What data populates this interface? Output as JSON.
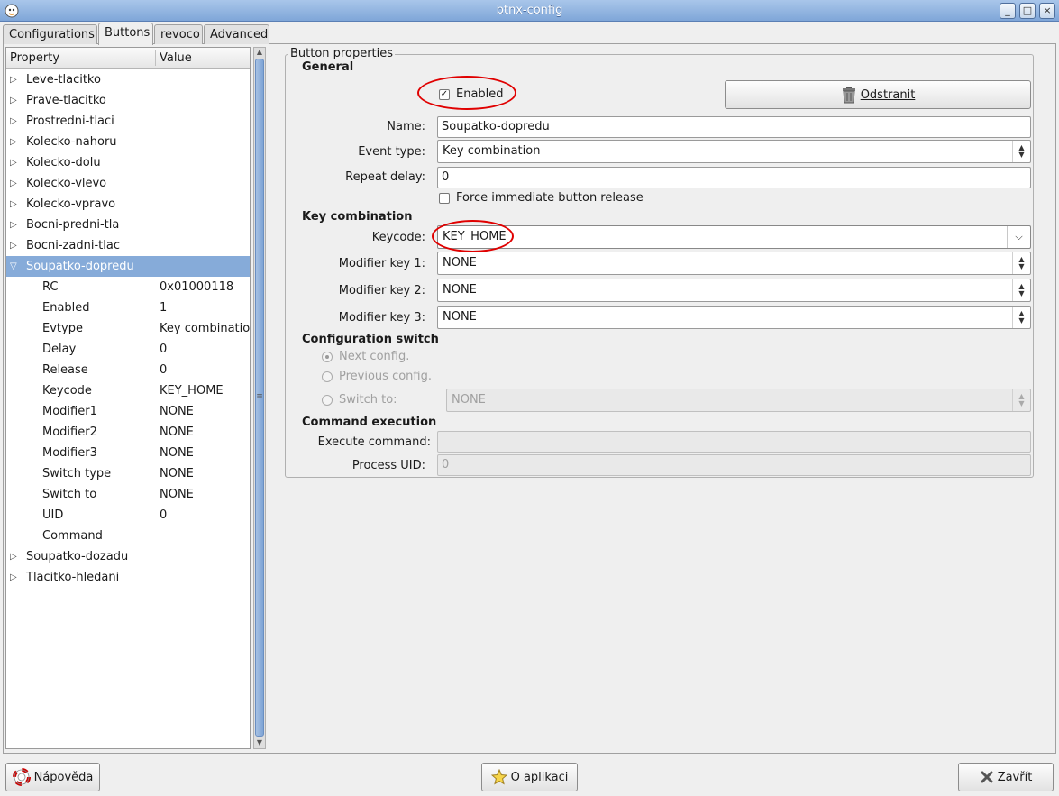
{
  "window": {
    "title": "btnx-config",
    "buttons": [
      "_",
      "□",
      "×"
    ]
  },
  "tabs": [
    {
      "label": "Configurations",
      "active": false
    },
    {
      "label": "Buttons",
      "active": true
    },
    {
      "label": "revoco",
      "active": false
    },
    {
      "label": "Advanced",
      "active": false
    }
  ],
  "tree": {
    "headers": {
      "property": "Property",
      "value": "Value"
    },
    "items_before": [
      "Leve-tlacitko",
      "Prave-tlacitko",
      "Prostredni-tlaci",
      "Kolecko-nahoru",
      "Kolecko-dolu",
      "Kolecko-vlevo",
      "Kolecko-vpravo",
      "Bocni-predni-tla",
      "Bocni-zadni-tlac"
    ],
    "selected": "Soupatko-dopredu",
    "children": [
      {
        "name": "RC",
        "value": "0x01000118"
      },
      {
        "name": "Enabled",
        "value": "1"
      },
      {
        "name": "Evtype",
        "value": "Key combinatio"
      },
      {
        "name": "Delay",
        "value": "0"
      },
      {
        "name": "Release",
        "value": "0"
      },
      {
        "name": "Keycode",
        "value": "KEY_HOME"
      },
      {
        "name": "Modifier1",
        "value": "NONE"
      },
      {
        "name": "Modifier2",
        "value": "NONE"
      },
      {
        "name": "Modifier3",
        "value": "NONE"
      },
      {
        "name": "Switch type",
        "value": "NONE"
      },
      {
        "name": "Switch to",
        "value": "NONE"
      },
      {
        "name": "UID",
        "value": "0"
      },
      {
        "name": "Command",
        "value": ""
      }
    ],
    "items_after": [
      "Soupatko-dozadu",
      "Tlacitko-hledani"
    ]
  },
  "props": {
    "frame_title": "Button properties",
    "general": {
      "heading": "General",
      "enabled_label": "Enabled",
      "enabled_checked": true,
      "remove_button": "Odstranit",
      "name_label": "Name:",
      "name_value": "Soupatko-dopredu",
      "event_type_label": "Event type:",
      "event_type_value": "Key combination",
      "repeat_delay_label": "Repeat delay:",
      "repeat_delay_value": "0",
      "force_release_label": "Force immediate button release",
      "force_release_checked": false
    },
    "keycomb": {
      "heading": "Key combination",
      "keycode_label": "Keycode:",
      "keycode_value": "KEY_HOME",
      "mod1_label": "Modifier key 1:",
      "mod1_value": "NONE",
      "mod2_label": "Modifier key 2:",
      "mod2_value": "NONE",
      "mod3_label": "Modifier key 3:",
      "mod3_value": "NONE"
    },
    "switch": {
      "heading": "Configuration switch",
      "next_label": "Next config.",
      "prev_label": "Previous config.",
      "switch_to_label": "Switch to:",
      "switch_to_value": "NONE"
    },
    "command": {
      "heading": "Command execution",
      "execute_label": "Execute command:",
      "execute_value": "",
      "uid_label": "Process UID:",
      "uid_value": "0"
    }
  },
  "footer": {
    "help_button": "Nápověda",
    "about_button": "O aplikaci",
    "close_button": "Zavřít"
  },
  "colors": {
    "selection": "#86abd9",
    "annotation": "#e00000",
    "titlebar": "#7fa6d8"
  }
}
